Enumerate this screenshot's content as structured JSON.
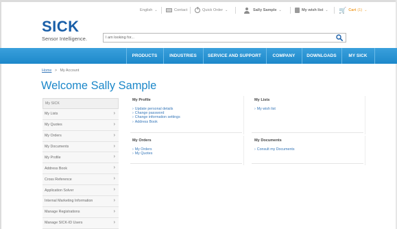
{
  "topbar": {
    "language": "English",
    "contact": "Contact",
    "quick_order": "Quick Order",
    "user": "Sally Sample",
    "wish_list": "My wish list",
    "cart": "Cart",
    "cart_count": "(1)"
  },
  "logo": {
    "brand": "SICK",
    "tagline": "Sensor Intelligence."
  },
  "search": {
    "placeholder": "I am looking for..."
  },
  "nav": {
    "items": [
      {
        "label": "PRODUCTS"
      },
      {
        "label": "INDUSTRIES"
      },
      {
        "label": "SERVICE AND SUPPORT"
      },
      {
        "label": "COMPANY"
      },
      {
        "label": "DOWNLOADS"
      },
      {
        "label": "MY SICK"
      }
    ]
  },
  "breadcrumb": {
    "home": "Home",
    "separator": ">",
    "current": "My Account"
  },
  "page": {
    "title": "Welcome Sally Sample"
  },
  "sidebar": {
    "header": "My SICK",
    "items": [
      {
        "label": "My Lists"
      },
      {
        "label": "My Quotes"
      },
      {
        "label": "My Orders"
      },
      {
        "label": "My Documents"
      },
      {
        "label": "My Profile"
      },
      {
        "label": "Address Book"
      },
      {
        "label": "Cross Reference"
      },
      {
        "label": "Application Solver"
      },
      {
        "label": "Internal Marketing Information"
      },
      {
        "label": "Manage Registrations"
      },
      {
        "label": "Manage SICK-ID Users"
      }
    ]
  },
  "panels": {
    "profile": {
      "title": "My Profile",
      "links": [
        "Update personal details",
        "Change password",
        "Change information settings",
        "Address Book"
      ]
    },
    "lists": {
      "title": "My Lists",
      "links": [
        "My wish list"
      ]
    },
    "orders": {
      "title": "My Orders",
      "links": [
        "My Orders",
        "My Quotes"
      ]
    },
    "documents": {
      "title": "My Documents",
      "links": [
        "Consult my Documents"
      ]
    }
  },
  "colors": {
    "brand_blue": "#1a5fa8",
    "nav_blue": "#2a94d3",
    "title_blue": "#1b87c9",
    "link_blue": "#3576b8",
    "cart_orange": "#f0a030"
  }
}
